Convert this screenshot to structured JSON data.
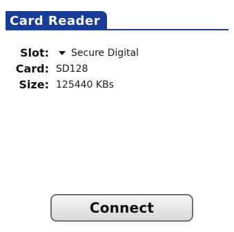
{
  "app": {
    "title": "Card Reader"
  },
  "form": {
    "slot": {
      "label": "Slot:",
      "value": "Secure Digital"
    },
    "card": {
      "label": "Card:",
      "value": "SD128"
    },
    "size": {
      "label": "Size:",
      "value": "125440 KBs"
    }
  },
  "actions": {
    "connect_label": "Connect"
  },
  "colors": {
    "title_bar": "#173d99",
    "background": "#ffffff"
  },
  "icons": {
    "slot_dropdown": "triangle-down-icon"
  }
}
